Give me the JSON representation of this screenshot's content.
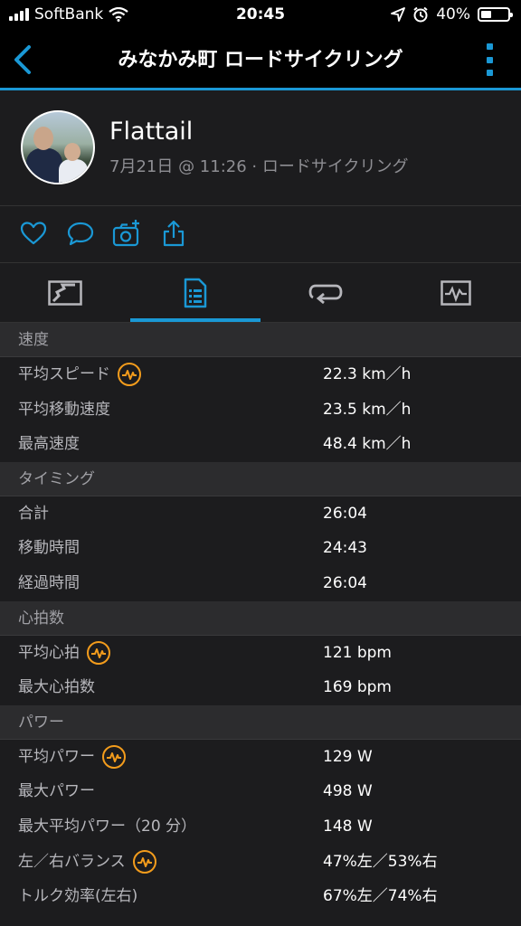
{
  "status_bar": {
    "carrier": "SoftBank",
    "time": "20:45",
    "battery": "40%",
    "battery_level": 0.4
  },
  "nav": {
    "title": "みなかみ町 ロードサイクリング"
  },
  "profile": {
    "name": "Flattail",
    "subtitle": "7月21日 @ 11:26 · ロードサイクリング"
  },
  "actions": [
    "heart-icon",
    "comment-icon",
    "camera-add-icon",
    "share-icon"
  ],
  "tabs": [
    "map-icon",
    "stats-list-icon",
    "laps-icon",
    "chart-icon"
  ],
  "sections": [
    {
      "title": "速度",
      "rows": [
        {
          "label": "平均スピード",
          "value": "22.3 km／h",
          "badge": true
        },
        {
          "label": "平均移動速度",
          "value": "23.5 km／h",
          "badge": false
        },
        {
          "label": "最高速度",
          "value": "48.4 km／h",
          "badge": false
        }
      ]
    },
    {
      "title": "タイミング",
      "rows": [
        {
          "label": "合計",
          "value": "26:04",
          "badge": false
        },
        {
          "label": "移動時間",
          "value": "24:43",
          "badge": false
        },
        {
          "label": "経過時間",
          "value": "26:04",
          "badge": false
        }
      ]
    },
    {
      "title": "心拍数",
      "rows": [
        {
          "label": "平均心拍",
          "value": "121 bpm",
          "badge": true
        },
        {
          "label": "最大心拍数",
          "value": "169 bpm",
          "badge": false
        }
      ]
    },
    {
      "title": "パワー",
      "rows": [
        {
          "label": "平均パワー",
          "value": "129 W",
          "badge": true
        },
        {
          "label": "最大パワー",
          "value": "498 W",
          "badge": false
        },
        {
          "label": "最大平均パワー（20 分）",
          "value": "148 W",
          "badge": false
        },
        {
          "label": "左／右バランス",
          "value": "47%左／53%右",
          "badge": true
        },
        {
          "label": "トルク効率(左右)",
          "value": "67%左／74%右",
          "badge": false
        }
      ]
    }
  ],
  "colors": {
    "accent": "#1a98d5",
    "badge": "#f39c1c",
    "background": "#1c1c1e",
    "header": "#2c2c2e"
  }
}
